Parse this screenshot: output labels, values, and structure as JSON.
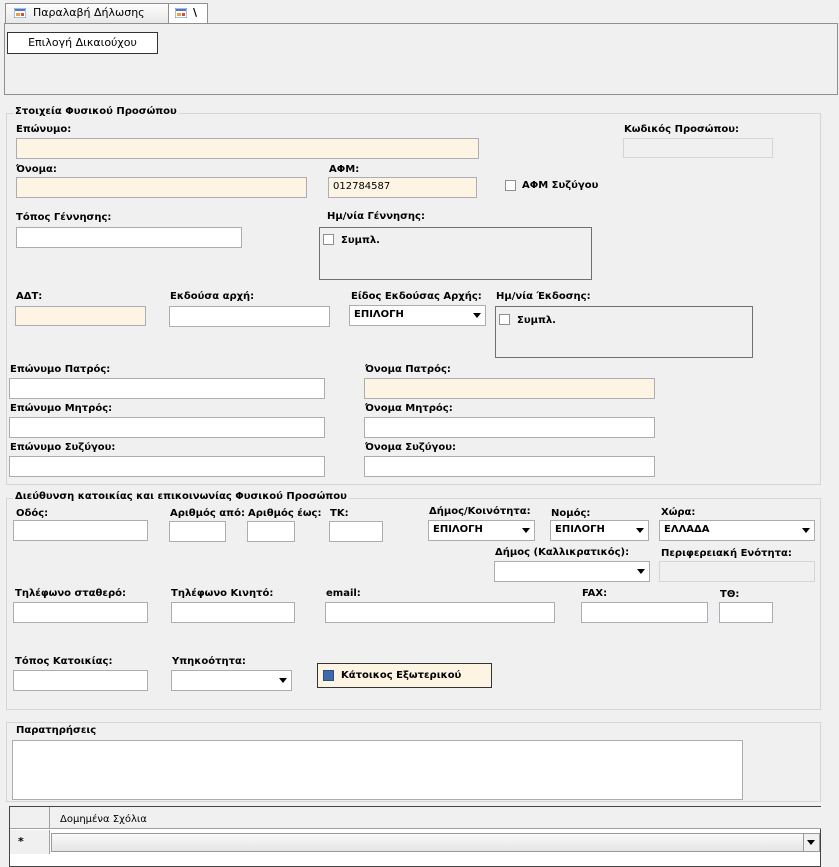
{
  "tabs": [
    {
      "label": "Παραλαβή Δήλωσης"
    },
    {
      "label": "\\"
    }
  ],
  "toolbar": {
    "select_beneficiary": "Επιλογή Δικαιούχου"
  },
  "person": {
    "section_title": "Στοιχεία Φυσικού Προσώπου",
    "surname_label": "Επώνυμο:",
    "surname_value": "",
    "person_code_label": "Κωδικός Προσώπου:",
    "person_code_value": "",
    "name_label": "Όνομα:",
    "name_value": "",
    "afm_label": "ΑΦΜ:",
    "afm_value": "012784587",
    "spouse_afm_label": "ΑΦΜ Συζύγου",
    "birthplace_label": "Τόπος Γέννησης:",
    "birthplace_value": "",
    "birthdate_label": "Ημ/νία Γέννησης:",
    "birthdate_check": "Συμπλ.",
    "adt_label": "ΑΔΤ:",
    "adt_value": "",
    "issuer_label": "Εκδούσα αρχή:",
    "issuer_value": "",
    "issuer_type_label": "Είδος Εκδούσας Αρχής:",
    "issuer_type_value": "ΕΠΙΛΟΓΗ",
    "issue_date_label": "Ημ/νία Έκδοσης:",
    "issue_date_check": "Συμπλ.",
    "father_surname_label": "Επώνυμο Πατρός:",
    "father_name_label": "Όνομα Πατρός:",
    "mother_surname_label": "Επώνυμο Μητρός:",
    "mother_name_label": "Όνομα Μητρός:",
    "spouse_surname_label": "Επώνυμο Συζύγου:",
    "spouse_name_label": "Όνομα Συζύγου:"
  },
  "address": {
    "section_title": "Διεύθυνση κατοικίας και επικοινωνίας Φυσικού Προσώπου",
    "street_label": "Οδός:",
    "num_from_label": "Αριθμός από:",
    "num_to_label": "Αριθμός έως:",
    "tk_label": "ΤΚ:",
    "municipality_label": "Δήμος/Κοινότητα:",
    "municipality_value": "ΕΠΙΛΟΓΗ",
    "prefecture_label": "Νομός:",
    "prefecture_value": "ΕΠΙΛΟΓΗ",
    "country_label": "Χώρα:",
    "country_value": "ΕΛΛΑΔΑ",
    "kallikratis_label": "Δήμος (Καλλικρατικός):",
    "kallikratis_value": "",
    "regional_unit_label": "Περιφερειακή Ενότητα:",
    "phone_label": "Τηλέφωνο σταθερό:",
    "mobile_label": "Τηλέφωνο Κινητό:",
    "email_label": "email:",
    "fax_label": "FAX:",
    "po_box_label": "ΤΘ:",
    "residence_label": "Τόπος Κατοικίας:",
    "citizenship_label": "Υπηκοότητα:",
    "citizenship_value": "",
    "abroad_label": "Κάτοικος Εξωτερικού"
  },
  "notes": {
    "label": "Παρατηρήσεις",
    "value": ""
  },
  "grid": {
    "column_header": "Δομημένα Σχόλια",
    "new_row_marker": "*"
  }
}
